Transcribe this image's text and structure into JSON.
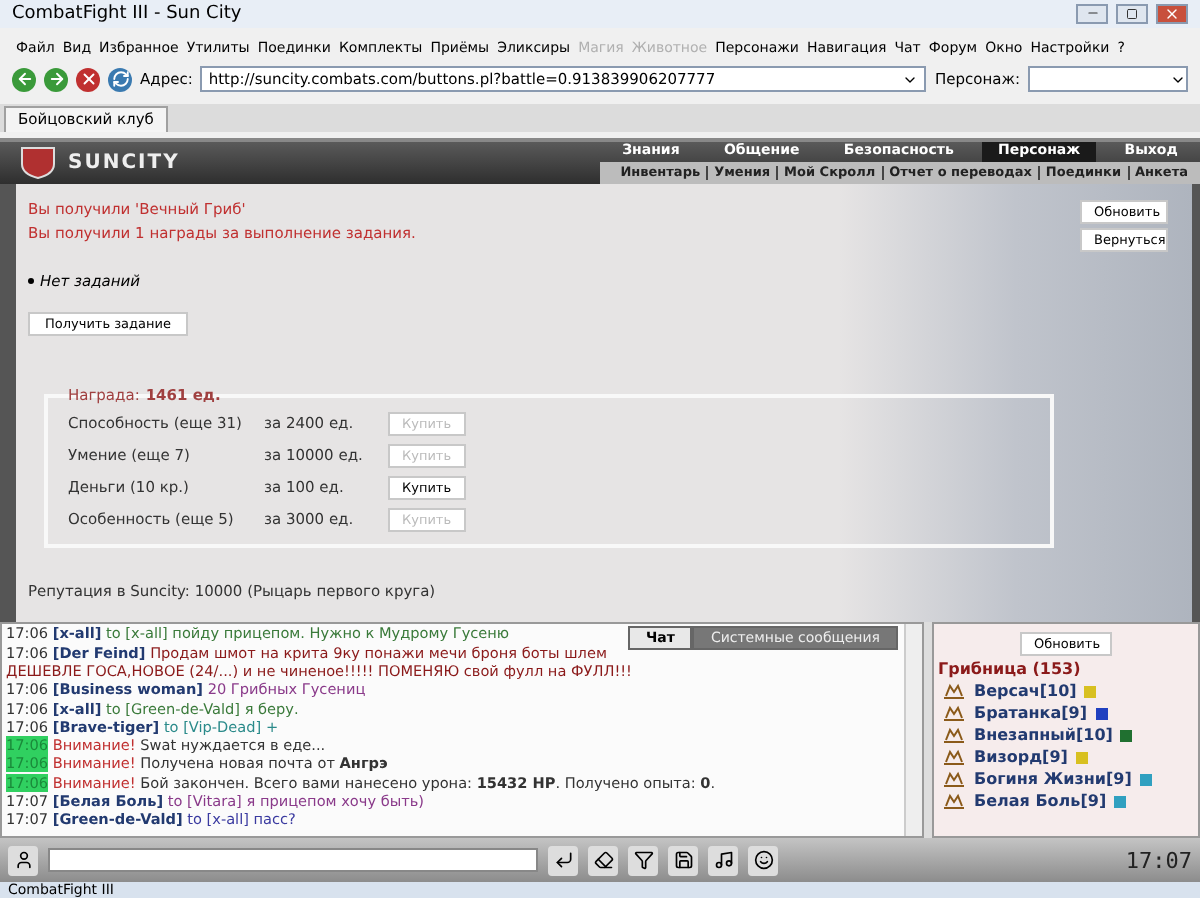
{
  "window": {
    "title": "CombatFight III - Sun City"
  },
  "menu": [
    {
      "label": "Файл",
      "disabled": false
    },
    {
      "label": "Вид",
      "disabled": false
    },
    {
      "label": "Избранное",
      "disabled": false
    },
    {
      "label": "Утилиты",
      "disabled": false
    },
    {
      "label": "Поединки",
      "disabled": false
    },
    {
      "label": "Комплекты",
      "disabled": false
    },
    {
      "label": "Приёмы",
      "disabled": false
    },
    {
      "label": "Эликсиры",
      "disabled": false
    },
    {
      "label": "Магия",
      "disabled": true
    },
    {
      "label": "Животное",
      "disabled": true
    },
    {
      "label": "Персонажи",
      "disabled": false
    },
    {
      "label": "Навигация",
      "disabled": false
    },
    {
      "label": "Чат",
      "disabled": false
    },
    {
      "label": "Форум",
      "disabled": false
    },
    {
      "label": "Окно",
      "disabled": false
    },
    {
      "label": "Настройки",
      "disabled": false
    },
    {
      "label": "?",
      "disabled": false
    }
  ],
  "address_bar": {
    "label": "Адрес:",
    "value": "http://suncity.combats.com/buttons.pl?battle=0.913839906207777",
    "character_label": "Персонаж:"
  },
  "tabs": [
    {
      "label": "Бойцовский клуб",
      "selected": true
    }
  ],
  "header": {
    "logo": "SUNCITY",
    "nav_top": [
      {
        "label": "Знания",
        "selected": false
      },
      {
        "label": "Общение",
        "selected": false
      },
      {
        "label": "Безопасность",
        "selected": false
      },
      {
        "label": "Персонаж",
        "selected": true
      },
      {
        "label": "Выход",
        "selected": false
      }
    ],
    "nav_bottom": [
      "Инвентарь",
      "Умения",
      "Мой Скролл",
      "Отчет о переводах",
      "Поединки",
      "Анкета"
    ]
  },
  "content": {
    "messages": [
      "Вы получили 'Вечный Гриб'",
      "Вы получили 1 награды за выполнение задания."
    ],
    "tasks": [
      "Нет заданий"
    ],
    "get_task_button": "Получить задание",
    "side_buttons": [
      "Обновить",
      "Вернуться"
    ],
    "reward": {
      "label": "Награда:",
      "value": "1461 ед."
    },
    "shop": [
      {
        "name": "Способность (еще 31)",
        "price": "за 2400 ед.",
        "button": "Купить",
        "disabled": true
      },
      {
        "name": "Умение (еще 7)",
        "price": "за 10000 ед.",
        "button": "Купить",
        "disabled": true
      },
      {
        "name": "Деньги (10 кр.)",
        "price": "за 100 ед.",
        "button": "Купить",
        "disabled": false
      },
      {
        "name": "Особенность (еще 5)",
        "price": "за 3000 ед.",
        "button": "Купить",
        "disabled": true
      }
    ],
    "reputation": "Репутация в Suncity: 10000 (Рыцарь первого круга)"
  },
  "chat": {
    "tabs": [
      {
        "label": "Чат",
        "selected": true
      },
      {
        "label": "Системные сообщения",
        "selected": false
      }
    ],
    "lines": [
      {
        "kind": "message",
        "time": "17:06",
        "sender": "[x-all]",
        "to": "to [x-all]",
        "text": "пойду прицепом. Нужно к Мудрому Гусеню",
        "color": "#3a7a3a"
      },
      {
        "kind": "message",
        "time": "17:06",
        "sender": "[Der Feind]",
        "text": "Продам шмот на крита 9ку понажи мечи броня боты шлем",
        "color": "#8b1a1a"
      },
      {
        "kind": "plain",
        "text": "ДЕШЕВЛЕ ГОСА,НОВОЕ (24/...) и не чиненое!!!!! ПОМЕНЯЮ свой фулл на ФУЛЛ!!!",
        "color": "#8b1a1a"
      },
      {
        "kind": "message",
        "time": "17:06",
        "sender": "[Business woman]",
        "text": "20 Грибных Гусениц",
        "color": "#8a3a8a"
      },
      {
        "kind": "message",
        "time": "17:06",
        "sender": "[x-all]",
        "to": "to [Green-de-Vald]",
        "text": "я беру.",
        "color": "#3a7a3a"
      },
      {
        "kind": "message",
        "time": "17:06",
        "sender": "[Brave-tiger]",
        "to": "to [Vip-Dead]",
        "text": "+",
        "color": "#2a8a8a"
      },
      {
        "kind": "system",
        "time": "17:06",
        "label": "Внимание!",
        "text": "Swat нуждается в еде..."
      },
      {
        "kind": "system",
        "time": "17:06",
        "label": "Внимание!",
        "text": "Получена новая почта от **Ангрэ**"
      },
      {
        "kind": "system",
        "time": "17:06",
        "label": "Внимание!",
        "text": "Бой закончен. Всего вами нанесено урона: **15432 HP**. Получено опыта: **0**."
      },
      {
        "kind": "message",
        "time": "17:07",
        "sender": "[Белая Боль]",
        "to": "to [Vitara]",
        "text": "я прицепом хочу быть)",
        "color": "#8a3a8a"
      },
      {
        "kind": "message",
        "time": "17:07",
        "sender": "[Green-de-Vald]",
        "to": "to [x-all]",
        "text": "пасс?",
        "color": "#3a3aa0"
      }
    ]
  },
  "online": {
    "refresh_button": "Обновить",
    "room": "Грибница (153)",
    "users": [
      {
        "name": "Версач[10]",
        "color": "#d8c020"
      },
      {
        "name": "Братанка[9]",
        "color": "#2040c0"
      },
      {
        "name": "Внезапный[10]",
        "color": "#207030"
      },
      {
        "name": "Визорд[9]",
        "color": "#d8c020"
      },
      {
        "name": "Богиня Жизни[9]",
        "color": "#30a0c0"
      },
      {
        "name": "Белая Боль[9]",
        "color": "#30a0c0"
      }
    ]
  },
  "clock": "17:07",
  "taskbar": {
    "items": [
      "CombatFight III"
    ]
  }
}
